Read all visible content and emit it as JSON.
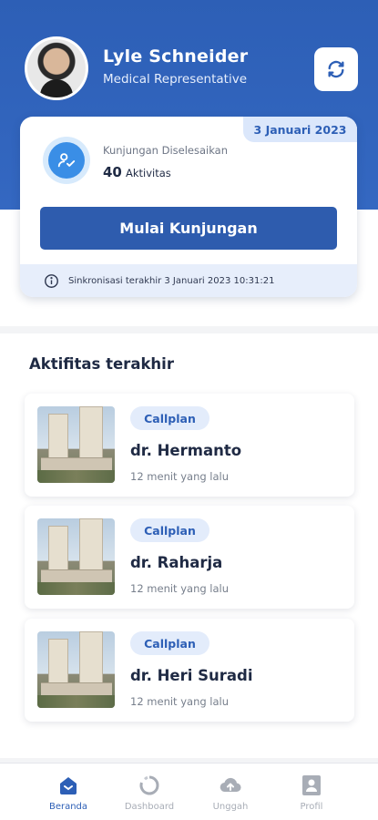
{
  "header": {
    "user_name": "Lyle Schneider",
    "user_role": "Medical Representative",
    "sync_icon": "refresh-icon"
  },
  "summary_card": {
    "date": "3 Januari 2023",
    "visits_label": "Kunjungan Diselesaikan",
    "visits_count": "40",
    "visits_unit": "Aktivitas",
    "start_button": "Mulai Kunjungan",
    "last_sync": "Sinkronisasi terakhir 3 Januari 2023 10:31:21"
  },
  "recent": {
    "title": "Aktifitas terakhir",
    "items": [
      {
        "tag": "Callplan",
        "name": "dr. Hermanto",
        "time": "12 menit yang lalu"
      },
      {
        "tag": "Callplan",
        "name": "dr. Raharja",
        "time": "12 menit yang lalu"
      },
      {
        "tag": "Callplan",
        "name": "dr. Heri Suradi",
        "time": "12 menit yang lalu"
      }
    ]
  },
  "nav": {
    "items": [
      {
        "label": "Beranda",
        "icon": "home-icon",
        "active": true
      },
      {
        "label": "Dashboard",
        "icon": "dashboard-icon",
        "active": false
      },
      {
        "label": "Unggah",
        "icon": "cloud-upload-icon",
        "active": false
      },
      {
        "label": "Profil",
        "icon": "profile-icon",
        "active": false
      }
    ]
  },
  "colors": {
    "primary": "#2d5fb6",
    "button": "#2e5cae",
    "tag_bg": "#e3ecfb",
    "inactive_nav": "#a8adb6"
  }
}
